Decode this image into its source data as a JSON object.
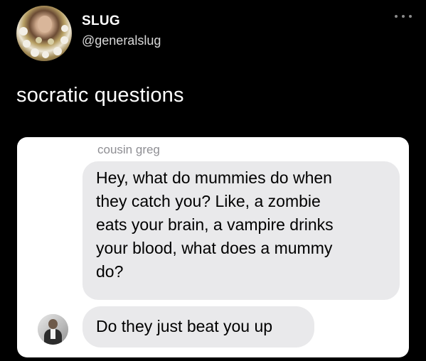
{
  "tweet": {
    "display_name": "SLUG",
    "handle": "@generalslug",
    "text": "socratic questions",
    "avatar_icon": "profile-photo-with-flower-garland",
    "more_icon": "more-horizontal-icon"
  },
  "screenshot": {
    "sender_name": "cousin greg",
    "contact_avatar_icon": "contact-photo",
    "messages": [
      {
        "lines": [
          "Hey, what do mummies do when",
          "they catch you? Like, a zombie",
          "eats your brain, a vampire drinks",
          "your blood, what does a mummy",
          "do?"
        ]
      },
      {
        "lines": [
          "Do they just beat you up"
        ]
      }
    ]
  },
  "colors": {
    "background": "#000000",
    "card_background": "#ffffff",
    "bubble_background": "#e9e9eb",
    "sender_name": "#8e8e93"
  }
}
